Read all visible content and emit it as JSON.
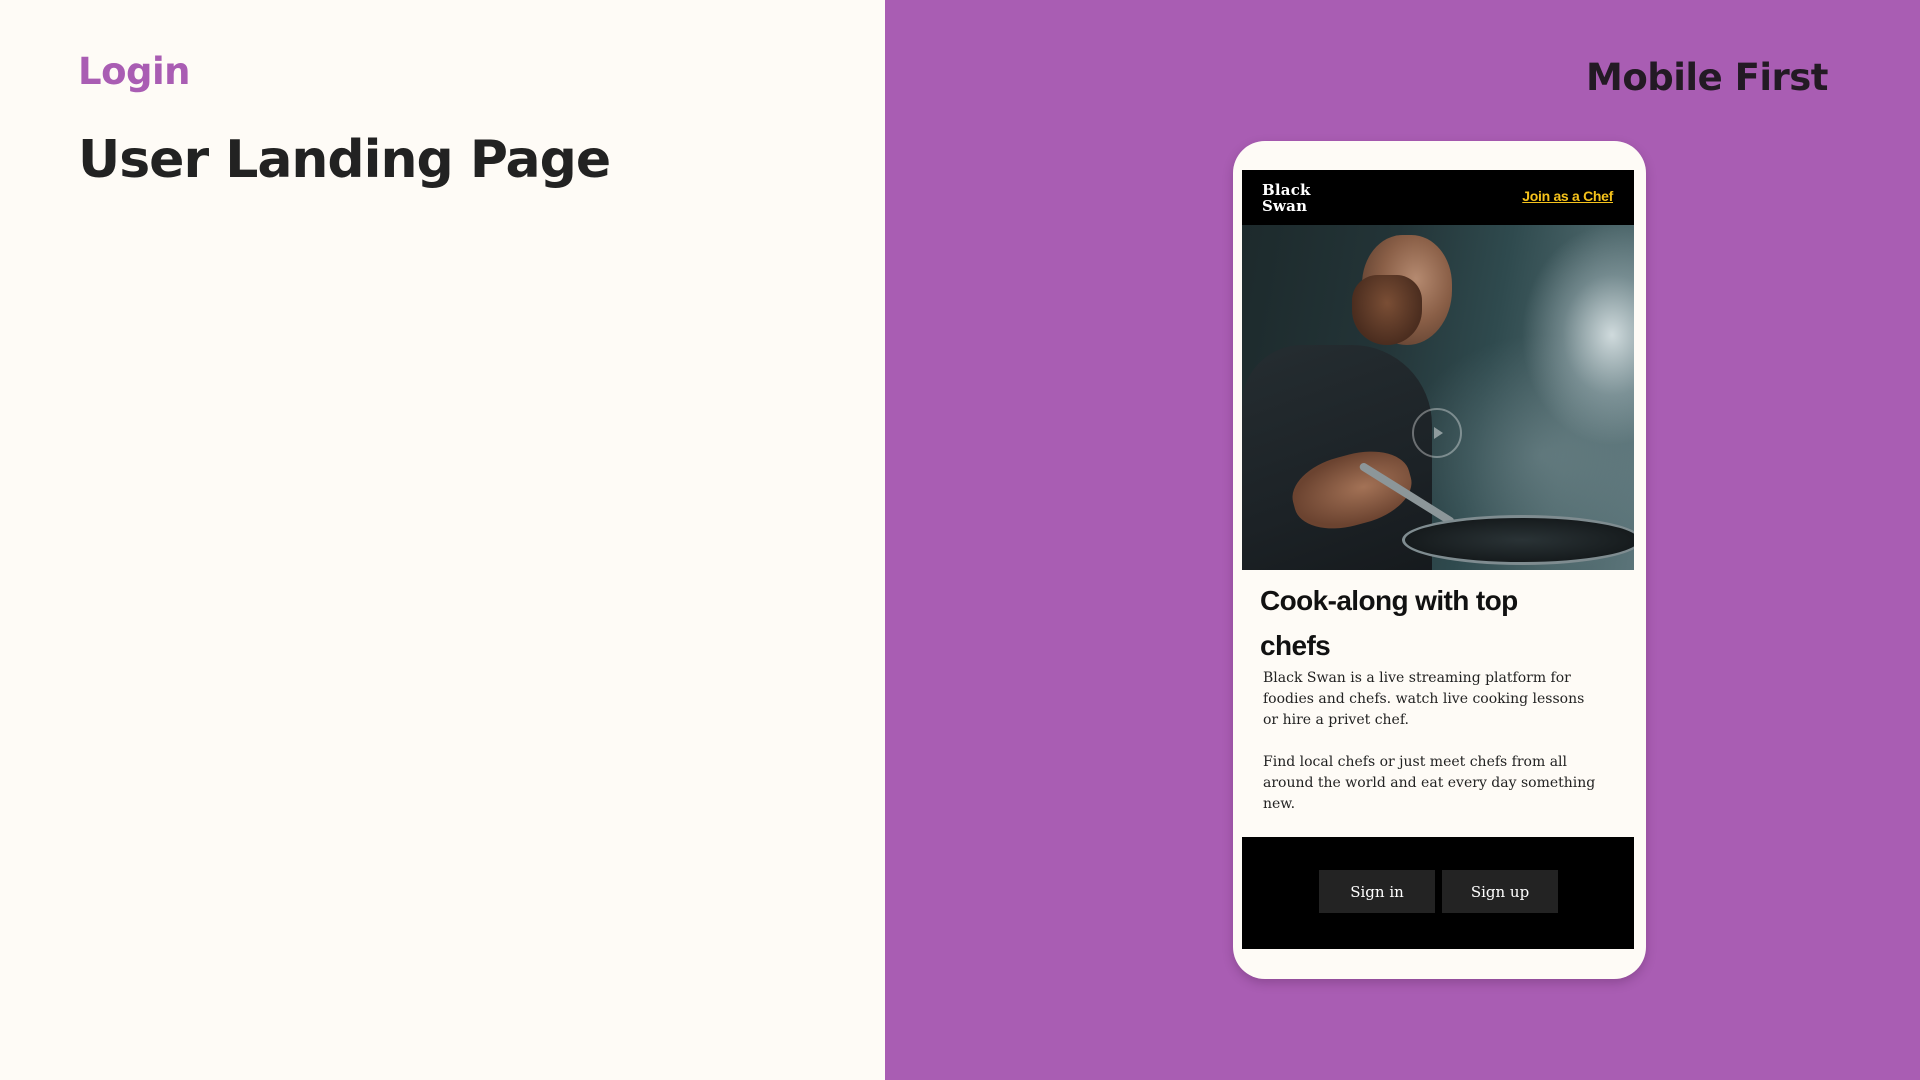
{
  "slide": {
    "eyebrow": "Login",
    "title": "User Landing Page",
    "tag": "Mobile First"
  },
  "app": {
    "logo_line1": "Black",
    "logo_line2": "Swan",
    "join_link": "Join as a Chef",
    "headline": "Cook-along with top chefs",
    "paragraph1": "Black Swan is a live streaming platform for foodies and chefs. watch live cooking lessons or hire a privet chef.",
    "paragraph2": "Find local chefs or just meet chefs from all around the world and  eat every day something new.",
    "signin_label": "Sign in",
    "signup_label": "Sign up",
    "hero_icon": "play-icon"
  },
  "colors": {
    "accent": "#a95db3",
    "link": "#f5c21b",
    "background": "#fefbf6",
    "header": "#000000"
  }
}
